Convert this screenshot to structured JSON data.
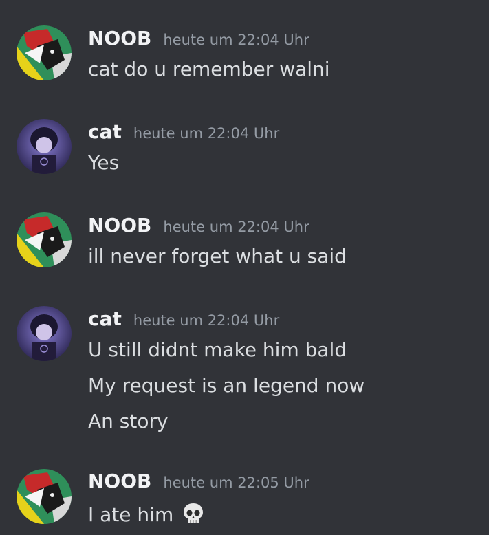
{
  "messages": [
    {
      "author": "NOOB",
      "avatar": "chainsaw-man-avatar-icon",
      "timestamp": "heute um 22:04 Uhr",
      "lines": [
        "cat do u remember walni"
      ]
    },
    {
      "author": "cat",
      "avatar": "dark-haired-character-avatar-icon",
      "timestamp": "heute um 22:04 Uhr",
      "lines": [
        "Yes"
      ]
    },
    {
      "author": "NOOB",
      "avatar": "chainsaw-man-avatar-icon",
      "timestamp": "heute um 22:04 Uhr",
      "lines": [
        "ill never forget what u said"
      ]
    },
    {
      "author": "cat",
      "avatar": "dark-haired-character-avatar-icon",
      "timestamp": "heute um 22:04 Uhr",
      "lines": [
        "U still didnt make him bald",
        "My request is an legend now",
        "An story"
      ]
    },
    {
      "author": "NOOB",
      "avatar": "chainsaw-man-avatar-icon",
      "timestamp": "heute um 22:05 Uhr",
      "lines": [
        "I ate him"
      ],
      "emoji": "skull-emoji-icon"
    }
  ],
  "colors": {
    "background": "#313338",
    "username": "#f2f3f5",
    "timestamp": "#949ba4",
    "message_text": "#dbdee1"
  }
}
